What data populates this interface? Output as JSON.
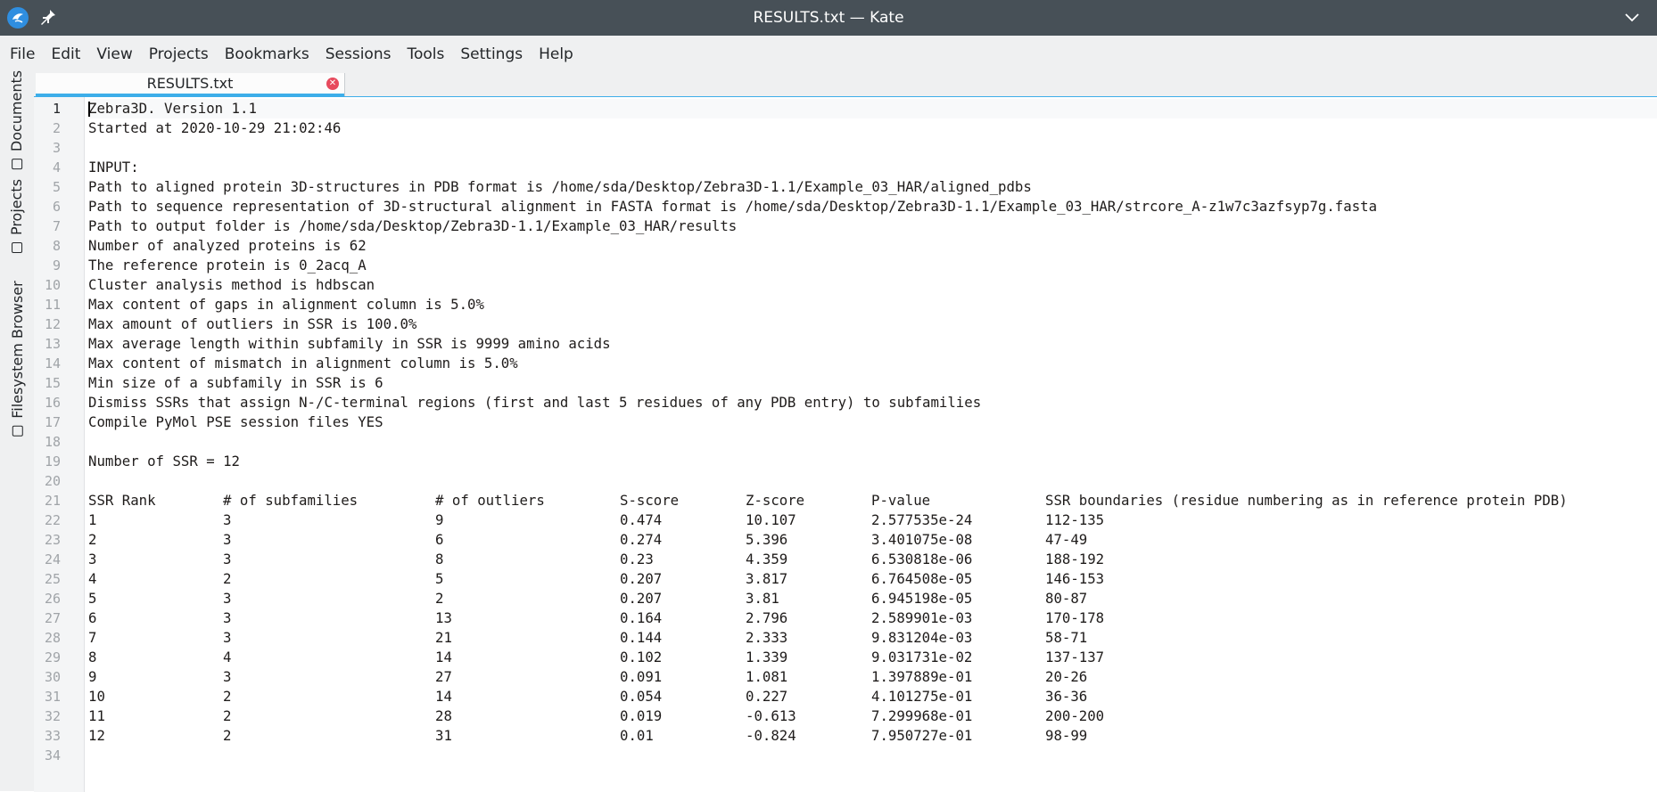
{
  "window": {
    "title": "RESULTS.txt — Kate",
    "app_icon": "kate-icon",
    "pin_icon": "pin-icon",
    "collapse_icon": "chevron-down-icon",
    "titlebar_color": "#475057",
    "accent_color": "#3daee9"
  },
  "menu": [
    "File",
    "Edit",
    "View",
    "Projects",
    "Bookmarks",
    "Sessions",
    "Tools",
    "Settings",
    "Help"
  ],
  "sidebar": {
    "tabs": [
      "Documents",
      "Projects",
      "Filesystem Browser"
    ]
  },
  "tabs": [
    {
      "label": "RESULTS.txt",
      "close_icon": "close-icon"
    }
  ],
  "editor": {
    "current_line": 1,
    "lines": [
      "Zebra3D. Version 1.1",
      "Started at 2020-10-29 21:02:46",
      "",
      "INPUT:",
      "Path to aligned protein 3D-structures in PDB format is /home/sda/Desktop/Zebra3D-1.1/Example_03_HAR/aligned_pdbs",
      "Path to sequence representation of 3D-structural alignment in FASTA format is /home/sda/Desktop/Zebra3D-1.1/Example_03_HAR/strcore_A-z1w7c3azfsyp7g.fasta",
      "Path to output folder is /home/sda/Desktop/Zebra3D-1.1/Example_03_HAR/results",
      "Number of analyzed proteins is 62",
      "The reference protein is 0_2acq_A",
      "Cluster analysis method is hdbscan",
      "Max content of gaps in alignment column is 5.0%",
      "Max amount of outliers in SSR is 100.0%",
      "Max average length within subfamily in SSR is 9999 amino acids",
      "Max content of mismatch in alignment column is 5.0%",
      "Min size of a subfamily in SSR is 6",
      "Dismiss SSRs that assign N-/C-terminal regions (first and last 5 residues of any PDB entry) to subfamilies",
      "Compile PyMol PSE session files YES",
      "",
      "Number of SSR = 12",
      ""
    ],
    "table": {
      "header": [
        "SSR Rank",
        "# of subfamilies",
        "# of outliers",
        "S-score",
        "Z-score",
        "P-value",
        "SSR boundaries (residue numbering as in reference protein PDB)"
      ],
      "rows": [
        [
          "1",
          "3",
          "9",
          "0.474",
          "10.107",
          "2.577535e-24",
          "112-135"
        ],
        [
          "2",
          "3",
          "6",
          "0.274",
          "5.396",
          "3.401075e-08",
          "47-49"
        ],
        [
          "3",
          "3",
          "8",
          "0.23",
          "4.359",
          "6.530818e-06",
          "188-192"
        ],
        [
          "4",
          "2",
          "5",
          "0.207",
          "3.817",
          "6.764508e-05",
          "146-153"
        ],
        [
          "5",
          "3",
          "2",
          "0.207",
          "3.81",
          "6.945198e-05",
          "80-87"
        ],
        [
          "6",
          "3",
          "13",
          "0.164",
          "2.796",
          "2.589901e-03",
          "170-178"
        ],
        [
          "7",
          "3",
          "21",
          "0.144",
          "2.333",
          "9.831204e-03",
          "58-71"
        ],
        [
          "8",
          "4",
          "14",
          "0.102",
          "1.339",
          "9.031731e-02",
          "137-137"
        ],
        [
          "9",
          "3",
          "27",
          "0.091",
          "1.081",
          "1.397889e-01",
          "20-26"
        ],
        [
          "10",
          "2",
          "14",
          "0.054",
          "0.227",
          "4.101275e-01",
          "36-36"
        ],
        [
          "11",
          "2",
          "28",
          "0.019",
          "-0.613",
          "7.299968e-01",
          "200-200"
        ],
        [
          "12",
          "2",
          "31",
          "0.01",
          "-0.824",
          "7.950727e-01",
          "98-99"
        ]
      ]
    },
    "trailing_lines": [
      ""
    ]
  }
}
